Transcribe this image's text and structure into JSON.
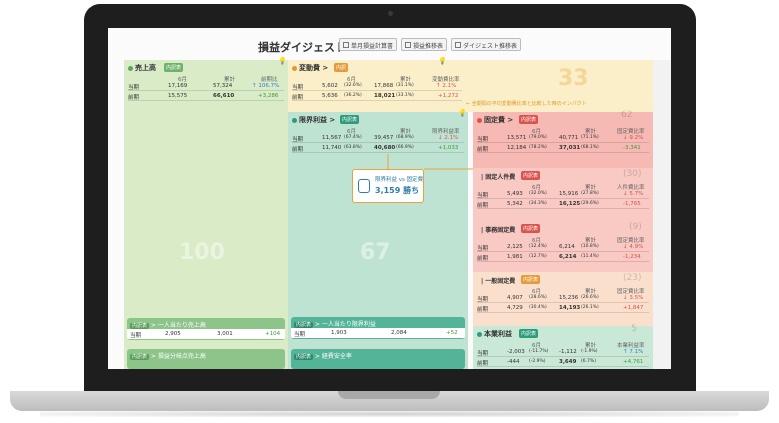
{
  "header": {
    "title": "損益ダイジェスト",
    "buttons": [
      "単月損益計算書",
      "損益推移表",
      "ダイジェスト推移表"
    ]
  },
  "sales": {
    "label": "売上高",
    "tag": "内訳表",
    "col_month": "6月",
    "col_total": "累計",
    "col_ratio": "前期比",
    "rows": [
      {
        "label": "当期",
        "month": "17,169",
        "total": "57,324",
        "ratio": "↑ 106.7%"
      },
      {
        "label": "前期",
        "month": "15,575",
        "total": "66,610",
        "ratio": "+3,286"
      }
    ],
    "big": "100",
    "sub_cards": [
      {
        "tag": "内訳表",
        "title": "一人当たり売上高",
        "row_label": "当期",
        "v1": "2,905",
        "v2": "3,001",
        "v3": "+104"
      },
      {
        "tag": "内訳表",
        "title": "損益分岐点売上高"
      }
    ]
  },
  "variable_cost": {
    "label": "変動費",
    "tag": "内訳",
    "col_month": "6月",
    "col_total": "累計",
    "col_ratio": "変動費比率",
    "rows": [
      {
        "label": "当期",
        "month": "5,602",
        "month_pct": "(32.6%)",
        "total": "17,868",
        "total_pct": "(31.1%)",
        "ratio": "↑ 2.1%"
      },
      {
        "label": "前期",
        "month": "5,636",
        "month_pct": "(36.2%)",
        "total": "18,021",
        "total_pct": "(33.1%)",
        "ratio": "+1,272"
      }
    ],
    "big": "33",
    "note": "← 全期間の平均変動費比率と比較した時のインパクト"
  },
  "gross_profit": {
    "label": "限界利益",
    "tag": "内訳表",
    "col_month": "6月",
    "col_total": "累計",
    "col_ratio": "限界利益率",
    "rows": [
      {
        "label": "当期",
        "month": "11,567",
        "month_pct": "(67.4%)",
        "total": "39,457",
        "total_pct": "(68.9%)",
        "ratio": "↓ 2.1%"
      },
      {
        "label": "前期",
        "month": "11,740",
        "month_pct": "(63.8%)",
        "total": "40,680",
        "total_pct": "(66.9%)",
        "ratio": "+1,033"
      }
    ],
    "big": "67",
    "sub_cards": [
      {
        "tag": "内訳表",
        "title": "一人当たり限界利益",
        "row_label": "当期",
        "v1": "1,903",
        "v2": "2,084",
        "v3": "+52"
      },
      {
        "tag": "内訳表",
        "title": "経費安全率"
      }
    ]
  },
  "bubble": {
    "line1": "限界利益 vs 固定費",
    "line2": "3,159 勝ち"
  },
  "fixed_cost": {
    "label": "固定費",
    "tag": "内訳表",
    "col_month": "6月",
    "col_total": "累計",
    "col_ratio": "固定費比率",
    "rows": [
      {
        "label": "当期",
        "month": "13,571",
        "month_pct": "(79.0%)",
        "total": "40,771",
        "total_pct": "(71.1%)",
        "ratio": "↓ 9.2%"
      },
      {
        "label": "前期",
        "month": "12,184",
        "month_pct": "(78.2%)",
        "total": "37,031",
        "total_pct": "(68.1%)",
        "ratio": "-3,341"
      }
    ],
    "corner": "62"
  },
  "personnel": {
    "label": "固定人件費",
    "tag": "内訳表",
    "corner": "(30)",
    "col_month": "6月",
    "col_total": "累計",
    "col_ratio": "人件費比率",
    "rows": [
      {
        "label": "当期",
        "month": "5,493",
        "month_pct": "(32.0%)",
        "total": "15,916",
        "total_pct": "(27.8%)",
        "ratio": "↓ 5.7%"
      },
      {
        "label": "前期",
        "month": "5,342",
        "month_pct": "(34.3%)",
        "total": "16,125",
        "total_pct": "(29.6%)",
        "ratio": "-1,765"
      }
    ]
  },
  "overhead": {
    "label": "事務固定費",
    "tag": "内訳表",
    "corner": "(9)",
    "col_month": "6月",
    "col_total": "累計",
    "col_ratio": "固定費比率",
    "rows": [
      {
        "label": "当期",
        "month": "2,125",
        "month_pct": "(12.4%)",
        "total": "6,214",
        "total_pct": "(10.8%)",
        "ratio": "↓ 4.9%"
      },
      {
        "label": "前期",
        "month": "1,981",
        "month_pct": "(12.7%)",
        "total": "6,214",
        "total_pct": "(11.4%)",
        "ratio": "-1,234"
      }
    ]
  },
  "other_cost": {
    "label": "一般固定費",
    "tag": "内訳表",
    "corner": "(23)",
    "col_month": "6月",
    "col_total": "累計",
    "col_ratio": "固定費比率",
    "rows": [
      {
        "label": "当期",
        "month": "4,907",
        "month_pct": "(28.6%)",
        "total": "15,236",
        "total_pct": "(26.6%)",
        "ratio": "↓ 3.5%"
      },
      {
        "label": "前期",
        "month": "4,729",
        "month_pct": "(30.4%)",
        "total": "14,193",
        "total_pct": "(26.1%)",
        "ratio": "+1,847"
      }
    ]
  },
  "profit": {
    "label": "本業利益",
    "tag": "内訳表",
    "corner": "5",
    "col_month": "6月",
    "col_total": "累計",
    "col_ratio": "本業利益率",
    "rows": [
      {
        "label": "当期",
        "month": "-2,003",
        "month_pct": "(-11.7%)",
        "total": "-1,112",
        "total_pct": "(-1.9%)",
        "ratio": "↑ 7.1%"
      },
      {
        "label": "前期",
        "month": "-444",
        "month_pct": "(-2.9%)",
        "total": "3,649",
        "total_pct": "(6.7%)",
        "ratio": "+4,761"
      }
    ]
  }
}
